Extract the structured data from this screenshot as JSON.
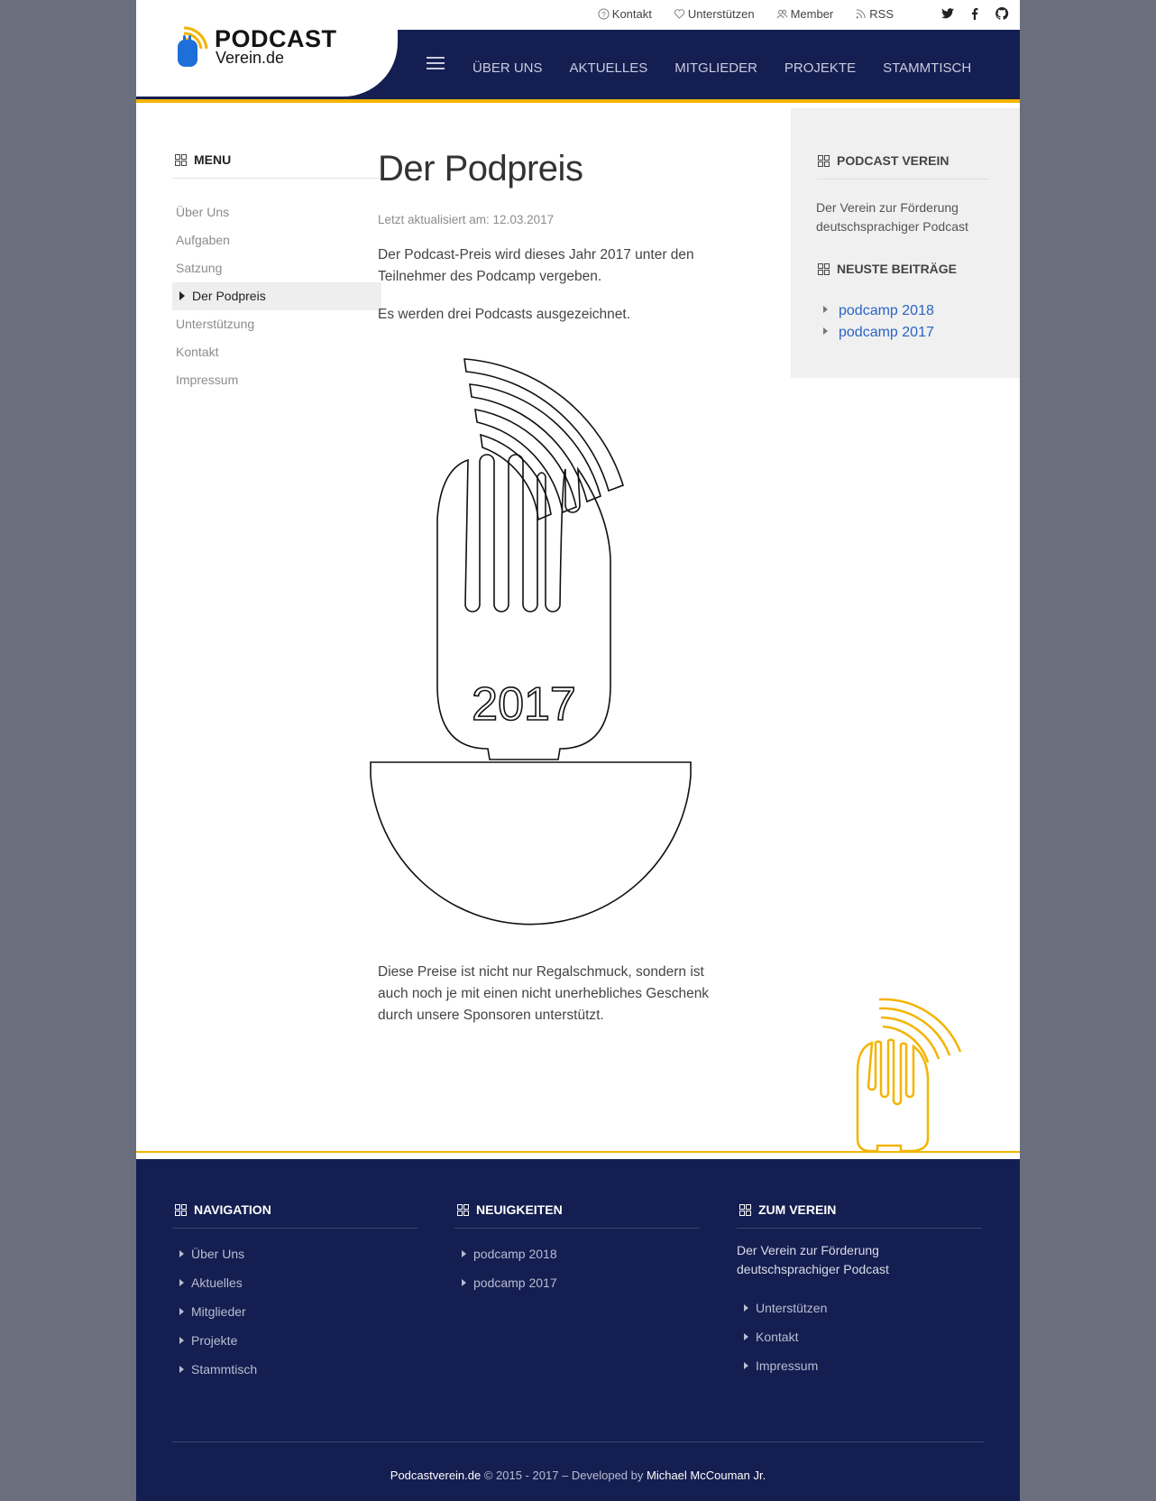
{
  "header": {
    "logo_line1": "PODCAST",
    "logo_line2": "Verein.de",
    "top_links": [
      "Kontakt",
      "Unterstützen",
      "Member",
      "RSS"
    ],
    "social_icons": [
      "twitter-icon",
      "facebook-icon",
      "github-icon"
    ],
    "nav": [
      "ÜBER UNS",
      "AKTUELLES",
      "MITGLIEDER",
      "PROJEKTE",
      "STAMMTISCH"
    ]
  },
  "sidebar": {
    "title": "MENU",
    "items": [
      "Über Uns",
      "Aufgaben",
      "Satzung",
      "Der Podpreis",
      "Unterstützung",
      "Kontakt",
      "Impressum"
    ],
    "active_index": 3
  },
  "article": {
    "title": "Der Podpreis",
    "updated": "Letzt aktualisiert am: 12.03.2017",
    "para1": "Der Podcast-Preis wird dieses Jahr 2017 unter den Teilnehmer des Podcamp vergeben.",
    "para2": "Es werden drei Podcasts ausgezeichnet.",
    "trophy_year": "2017",
    "para3": "Diese Preise ist nicht nur Regalschmuck, sondern ist auch noch je mit einen nicht unerhebliches Geschenk durch unsere Sponsoren unterstützt."
  },
  "right_sidebar": {
    "title1": "PODCAST VEREIN",
    "text": "Der Verein zur Förderung deutschsprachiger Podcast",
    "title2": "NEUSTE BEITRÄGE",
    "posts": [
      "podcamp 2018",
      "podcamp 2017"
    ]
  },
  "footer": {
    "col1_title": "NAVIGATION",
    "col1_items": [
      "Über Uns",
      "Aktuelles",
      "Mitglieder",
      "Projekte",
      "Stammtisch"
    ],
    "col2_title": "NEUIGKEITEN",
    "col2_items": [
      "podcamp 2018",
      "podcamp 2017"
    ],
    "col3_title": "ZUM VEREIN",
    "col3_text": "Der Verein zur Förderung deutschsprachiger Podcast",
    "col3_items": [
      "Unterstützen",
      "Kontakt",
      "Impressum"
    ],
    "copyright_site": "Podcastverein.de",
    "copyright_mid": " © 2015 - 2017 – Developed by ",
    "copyright_author": "Michael McCouman Jr."
  },
  "colors": {
    "navy": "#141e50",
    "accent_yellow": "#f4b400",
    "link_blue": "#2a64c5",
    "logo_blue": "#1e6fd9"
  }
}
